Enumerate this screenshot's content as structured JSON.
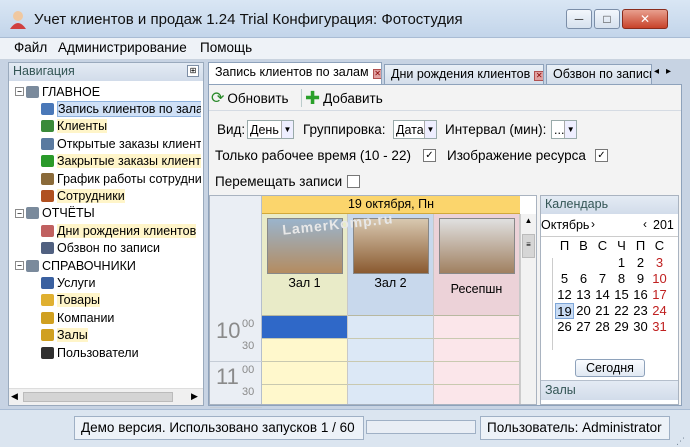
{
  "window": {
    "title": "Учет клиентов и продаж 1.24 Trial   Конфигурация: Фотостудия",
    "minimize": "─",
    "maximize": "□",
    "close": "✕"
  },
  "menu": [
    "Файл",
    "Администрирование",
    "Помощь"
  ],
  "nav": {
    "header": "Навигация",
    "pin": "⊞",
    "items": [
      {
        "label": "ГЛАВНОЕ",
        "level": 0,
        "expander": "−",
        "icon": "list-icon",
        "color": "#7a8a9c"
      },
      {
        "label": "Запись клиентов по залам",
        "level": 1,
        "icon": "calendar-icon",
        "color": "#4a78b8",
        "selected": true
      },
      {
        "label": "Клиенты",
        "level": 1,
        "icon": "users-icon",
        "color": "#3a8a3a",
        "highlight": true
      },
      {
        "label": "Открытые заказы клиентов",
        "level": 1,
        "icon": "cart-icon",
        "color": "#5a7aa0"
      },
      {
        "label": "Закрытые заказы клиентов",
        "level": 1,
        "icon": "check-icon",
        "color": "#2a9a2a",
        "highlight": true
      },
      {
        "label": "График работы сотрудников",
        "level": 1,
        "icon": "chart-icon",
        "color": "#8a6a3a"
      },
      {
        "label": "Сотрудники",
        "level": 1,
        "icon": "person-icon",
        "color": "#b05020",
        "highlight": true
      },
      {
        "label": "ОТЧЁТЫ",
        "level": 0,
        "expander": "−",
        "icon": "report-icon",
        "color": "#7a8a9c"
      },
      {
        "label": "Дни рождения клиентов",
        "level": 1,
        "icon": "cake-icon",
        "color": "#c06060",
        "highlight": true
      },
      {
        "label": "Обзвон по записи",
        "level": 1,
        "icon": "phone-icon",
        "color": "#506080"
      },
      {
        "label": "СПРАВОЧНИКИ",
        "level": 0,
        "expander": "−",
        "icon": "book-icon",
        "color": "#7a8a9c"
      },
      {
        "label": "Услуги",
        "level": 1,
        "icon": "services-icon",
        "color": "#3a60a0"
      },
      {
        "label": "Товары",
        "level": 1,
        "icon": "folder-icon",
        "color": "#e0b030",
        "highlight": true
      },
      {
        "label": "Компании",
        "level": 1,
        "icon": "company-icon",
        "color": "#d0a020"
      },
      {
        "label": "Залы",
        "level": 1,
        "icon": "room-icon",
        "color": "#d0a020",
        "highlight": true
      },
      {
        "label": "Пользователи",
        "level": 1,
        "icon": "user-icon",
        "color": "#303030"
      }
    ]
  },
  "tabs": [
    {
      "label": "Запись клиентов по залам",
      "active": true
    },
    {
      "label": "Дни рождения клиентов"
    },
    {
      "label": "Обзвон по записи"
    }
  ],
  "toolbar": {
    "refresh": "Обновить",
    "add": "Добавить"
  },
  "filters": {
    "view_label": "Вид:",
    "view_value": "День",
    "group_label": "Группировка:",
    "group_value": "Дата",
    "interval_label": "Интервал (мин):",
    "interval_value": "...",
    "work_time_label": "Только рабочее время (10 - 22)",
    "work_time_checked": true,
    "resource_image_label": "Изображение ресурса",
    "resource_image_checked": true,
    "move_label": "Перемещать записи",
    "move_checked": false
  },
  "schedule": {
    "date": "19 октября, Пн",
    "watermark": "LamerKomp.ru",
    "rooms": [
      {
        "name": "Зал 1",
        "color": "#e9ebc8"
      },
      {
        "name": "Зал 2",
        "color": "#c8d8ec"
      },
      {
        "name": "Ресепшн",
        "color": "#ecd2d8"
      }
    ],
    "times": [
      {
        "hour": "10",
        "min1": "00",
        "min2": "30"
      },
      {
        "hour": "11",
        "min1": "00",
        "min2": "30"
      }
    ]
  },
  "calendar": {
    "header": "Календарь",
    "month": "Октябрь",
    "year": "201",
    "weekdays": [
      "П",
      "В",
      "С",
      "Ч",
      "П",
      "С"
    ],
    "rows": [
      [
        "",
        "",
        "",
        "1",
        "2",
        "3"
      ],
      [
        "5",
        "6",
        "7",
        "8",
        "9",
        "10"
      ],
      [
        "12",
        "13",
        "14",
        "15",
        "16",
        "17"
      ],
      [
        "19",
        "20",
        "21",
        "22",
        "23",
        "24"
      ],
      [
        "26",
        "27",
        "28",
        "29",
        "30",
        "31"
      ]
    ],
    "week_nums": [
      "",
      "",
      "",
      "",
      "",
      ""
    ],
    "today": "Сегодня",
    "rooms_header": "Залы"
  },
  "status": {
    "demo": "Демо версия. Использовано запусков 1 / 60",
    "user": "Пользователь: Administrator"
  }
}
